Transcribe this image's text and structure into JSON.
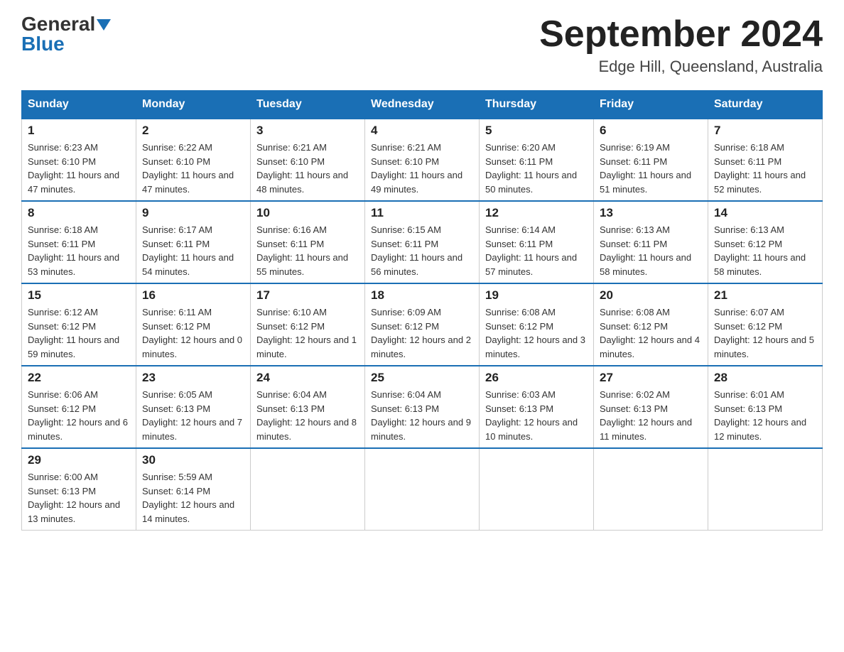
{
  "logo": {
    "general": "General",
    "blue": "Blue"
  },
  "title": {
    "month": "September 2024",
    "location": "Edge Hill, Queensland, Australia"
  },
  "headers": [
    "Sunday",
    "Monday",
    "Tuesday",
    "Wednesday",
    "Thursday",
    "Friday",
    "Saturday"
  ],
  "weeks": [
    [
      {
        "day": "1",
        "sunrise": "6:23 AM",
        "sunset": "6:10 PM",
        "daylight": "11 hours and 47 minutes."
      },
      {
        "day": "2",
        "sunrise": "6:22 AM",
        "sunset": "6:10 PM",
        "daylight": "11 hours and 47 minutes."
      },
      {
        "day": "3",
        "sunrise": "6:21 AM",
        "sunset": "6:10 PM",
        "daylight": "11 hours and 48 minutes."
      },
      {
        "day": "4",
        "sunrise": "6:21 AM",
        "sunset": "6:10 PM",
        "daylight": "11 hours and 49 minutes."
      },
      {
        "day": "5",
        "sunrise": "6:20 AM",
        "sunset": "6:11 PM",
        "daylight": "11 hours and 50 minutes."
      },
      {
        "day": "6",
        "sunrise": "6:19 AM",
        "sunset": "6:11 PM",
        "daylight": "11 hours and 51 minutes."
      },
      {
        "day": "7",
        "sunrise": "6:18 AM",
        "sunset": "6:11 PM",
        "daylight": "11 hours and 52 minutes."
      }
    ],
    [
      {
        "day": "8",
        "sunrise": "6:18 AM",
        "sunset": "6:11 PM",
        "daylight": "11 hours and 53 minutes."
      },
      {
        "day": "9",
        "sunrise": "6:17 AM",
        "sunset": "6:11 PM",
        "daylight": "11 hours and 54 minutes."
      },
      {
        "day": "10",
        "sunrise": "6:16 AM",
        "sunset": "6:11 PM",
        "daylight": "11 hours and 55 minutes."
      },
      {
        "day": "11",
        "sunrise": "6:15 AM",
        "sunset": "6:11 PM",
        "daylight": "11 hours and 56 minutes."
      },
      {
        "day": "12",
        "sunrise": "6:14 AM",
        "sunset": "6:11 PM",
        "daylight": "11 hours and 57 minutes."
      },
      {
        "day": "13",
        "sunrise": "6:13 AM",
        "sunset": "6:11 PM",
        "daylight": "11 hours and 58 minutes."
      },
      {
        "day": "14",
        "sunrise": "6:13 AM",
        "sunset": "6:12 PM",
        "daylight": "11 hours and 58 minutes."
      }
    ],
    [
      {
        "day": "15",
        "sunrise": "6:12 AM",
        "sunset": "6:12 PM",
        "daylight": "11 hours and 59 minutes."
      },
      {
        "day": "16",
        "sunrise": "6:11 AM",
        "sunset": "6:12 PM",
        "daylight": "12 hours and 0 minutes."
      },
      {
        "day": "17",
        "sunrise": "6:10 AM",
        "sunset": "6:12 PM",
        "daylight": "12 hours and 1 minute."
      },
      {
        "day": "18",
        "sunrise": "6:09 AM",
        "sunset": "6:12 PM",
        "daylight": "12 hours and 2 minutes."
      },
      {
        "day": "19",
        "sunrise": "6:08 AM",
        "sunset": "6:12 PM",
        "daylight": "12 hours and 3 minutes."
      },
      {
        "day": "20",
        "sunrise": "6:08 AM",
        "sunset": "6:12 PM",
        "daylight": "12 hours and 4 minutes."
      },
      {
        "day": "21",
        "sunrise": "6:07 AM",
        "sunset": "6:12 PM",
        "daylight": "12 hours and 5 minutes."
      }
    ],
    [
      {
        "day": "22",
        "sunrise": "6:06 AM",
        "sunset": "6:12 PM",
        "daylight": "12 hours and 6 minutes."
      },
      {
        "day": "23",
        "sunrise": "6:05 AM",
        "sunset": "6:13 PM",
        "daylight": "12 hours and 7 minutes."
      },
      {
        "day": "24",
        "sunrise": "6:04 AM",
        "sunset": "6:13 PM",
        "daylight": "12 hours and 8 minutes."
      },
      {
        "day": "25",
        "sunrise": "6:04 AM",
        "sunset": "6:13 PM",
        "daylight": "12 hours and 9 minutes."
      },
      {
        "day": "26",
        "sunrise": "6:03 AM",
        "sunset": "6:13 PM",
        "daylight": "12 hours and 10 minutes."
      },
      {
        "day": "27",
        "sunrise": "6:02 AM",
        "sunset": "6:13 PM",
        "daylight": "12 hours and 11 minutes."
      },
      {
        "day": "28",
        "sunrise": "6:01 AM",
        "sunset": "6:13 PM",
        "daylight": "12 hours and 12 minutes."
      }
    ],
    [
      {
        "day": "29",
        "sunrise": "6:00 AM",
        "sunset": "6:13 PM",
        "daylight": "12 hours and 13 minutes."
      },
      {
        "day": "30",
        "sunrise": "5:59 AM",
        "sunset": "6:14 PM",
        "daylight": "12 hours and 14 minutes."
      },
      null,
      null,
      null,
      null,
      null
    ]
  ],
  "labels": {
    "sunrise": "Sunrise:",
    "sunset": "Sunset:",
    "daylight": "Daylight:"
  }
}
